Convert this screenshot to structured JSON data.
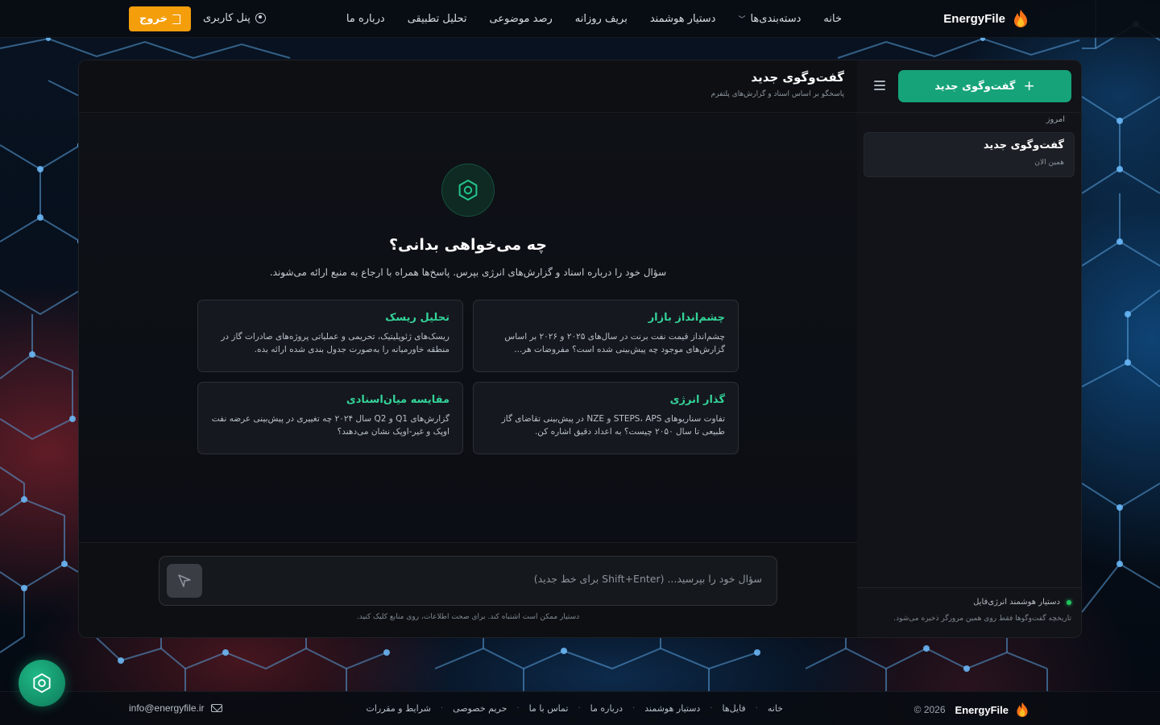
{
  "header": {
    "brand": "EnergyFile",
    "nav": [
      {
        "label": "خانه"
      },
      {
        "label": "دسته‌بندی‌ها",
        "has_dropdown": true
      },
      {
        "label": "دستیار هوشمند"
      },
      {
        "label": "بریف روزانه"
      },
      {
        "label": "رصد موضوعی"
      },
      {
        "label": "تحلیل تطبیقی"
      },
      {
        "label": "درباره ما"
      }
    ],
    "user_panel": "پنل کاربری",
    "logout": "خروج"
  },
  "sidebar": {
    "new_chat": "گفت‌وگوی جدید",
    "section_today": "امروز",
    "sessions": [
      {
        "title": "گفت‌وگوی جدید",
        "time": "همین الان"
      }
    ],
    "footer_status": "دستیار هوشمند انرژی‌فایل",
    "footer_note": "تاریخچه گفت‌وگوها فقط روی همین مرورگر ذخیره می‌شود."
  },
  "chat": {
    "title": "گفت‌وگوی جدید",
    "subtitle": "پاسخگو بر اساس اسناد و گزارش‌های پلتفرم",
    "hero_title": "چه می‌خواهی بدانی؟",
    "hero_subtitle": "سؤال خود را درباره اسناد و گزارش‌های انرژی بپرس. پاسخ‌ها همراه با ارجاع به منبع ارائه می‌شوند.",
    "suggestions": [
      {
        "title": "چشم‌انداز بازار",
        "text": "چشم‌انداز قیمت نفت برنت در سال‌های ۲۰۲۵ و ۲۰۲۶ بر اساس گزارش‌های موجود چه پیش‌بینی شده است؟ مفروضات هر..."
      },
      {
        "title": "تحلیل ریسک",
        "text": "ریسک‌های ژئوپلیتیک، تحریمی و عملیاتی پروژه‌های صادرات گاز در منطقه خاورمیانه را به‌صورت جدول بندی شده ارائه بده."
      },
      {
        "title": "گذار انرژی",
        "text": "تفاوت سناریوهای STEPS، APS و NZE در پیش‌بینی تقاضای گاز طبیعی تا سال ۲۰۵۰ چیست؟ به اعداد دقیق اشاره کن."
      },
      {
        "title": "مقایسه میان‌اسنادی",
        "text": "گزارش‌های Q1 و Q2 سال ۲۰۲۴ چه تغییری در پیش‌بینی عرضه نفت اوپک و غیر-اوپک نشان می‌دهند؟"
      }
    ],
    "input_placeholder": "سؤال خود را بپرسید... (Shift+Enter برای خط جدید)",
    "input_value": "",
    "disclaimer": "دستیار ممکن است اشتباه کند. برای صحت اطلاعات، روی منابع کلیک کنید."
  },
  "footer": {
    "brand": "EnergyFile",
    "copyright": "© 2026",
    "links": [
      "خانه",
      "فایل‌ها",
      "دستیار هوشمند",
      "درباره ما",
      "تماس با ما",
      "حریم خصوصی",
      "شرایط و مقررات"
    ],
    "email": "info@energyfile.ir"
  },
  "icons": {
    "brand": "flame-icon",
    "fab": "assistant-hexagon-icon",
    "send": "send-arrow-icon"
  },
  "colors": {
    "accent_green": "#16a37a",
    "suggestion_title": "#34d399",
    "logout_orange": "#f59e0b",
    "status_dot": "#22c55e"
  }
}
